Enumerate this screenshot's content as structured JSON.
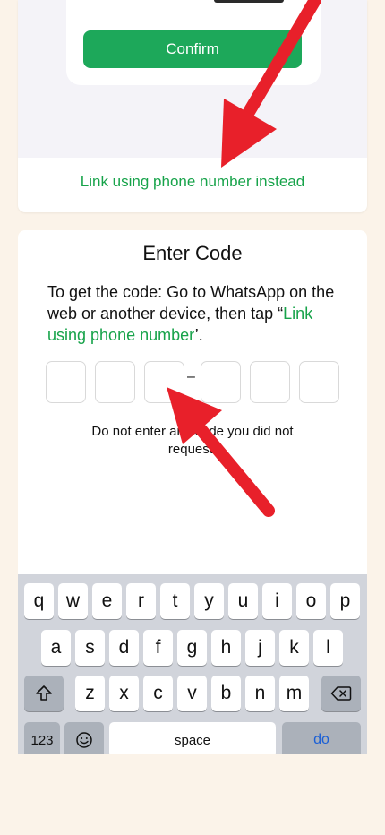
{
  "top_card": {
    "confirm_label": "Confirm",
    "link_label": "Link using phone number instead"
  },
  "enter_code": {
    "title": "Enter Code",
    "instructions_prefix": "To get the code: Go to WhatsApp on the web or another device, then tap “",
    "instructions_link": "Link using phone number",
    "instructions_suffix": "’.",
    "dash": "–",
    "warning": "Do not enter any code you did not request."
  },
  "keyboard": {
    "row1": [
      "q",
      "w",
      "e",
      "r",
      "t",
      "y",
      "u",
      "i",
      "o",
      "p"
    ],
    "row2": [
      "a",
      "s",
      "d",
      "f",
      "g",
      "h",
      "j",
      "k",
      "l"
    ],
    "row3": [
      "z",
      "x",
      "c",
      "v",
      "b",
      "n",
      "m"
    ],
    "numbers_label": "123",
    "space_label": "space",
    "done_label": "do"
  },
  "colors": {
    "accent_green": "#1da85a",
    "arrow_red": "#e8202a",
    "background": "#fbf3e9"
  },
  "icons": [
    "shift-icon",
    "backspace-icon",
    "emoji-icon",
    "red-arrow-icon"
  ]
}
